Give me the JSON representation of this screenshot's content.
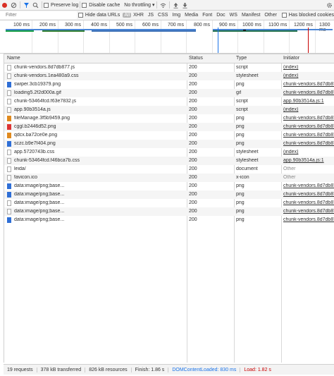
{
  "toolbar": {
    "preserve_log": "Preserve log",
    "disable_cache": "Disable cache",
    "throttling": "No throttling"
  },
  "filterbar": {
    "placeholder": "Filter",
    "hide_data_urls": "Hide data URLs",
    "types": [
      "All",
      "XHR",
      "JS",
      "CSS",
      "Img",
      "Media",
      "Font",
      "Doc",
      "WS",
      "Manifest",
      "Other"
    ],
    "selected_type": "All",
    "has_blocked_cookies": "Has blocked cookies"
  },
  "overview": {
    "ticks": [
      "100 ms",
      "200 ms",
      "300 ms",
      "400 ms",
      "500 ms",
      "600 ms",
      "700 ms",
      "800 ms",
      "900 ms",
      "1000 ms",
      "1100 ms",
      "1200 ms",
      "1300 ms"
    ]
  },
  "table": {
    "headers": {
      "name": "Name",
      "status": "Status",
      "type": "Type",
      "initiator": "Initiator"
    },
    "rows": [
      {
        "name": "chunk-vendors.8d7db877.js",
        "status": "200",
        "type": "script",
        "initiator": "(index)",
        "icon": "script"
      },
      {
        "name": "chunk-vendors.1ea480a9.css",
        "status": "200",
        "type": "stylesheet",
        "initiator": "(index)",
        "icon": "doc"
      },
      {
        "name": "swiper.3cb19379.png",
        "status": "200",
        "type": "png",
        "initiator": "chunk-vendors.8d7db877",
        "icon": "img-blue"
      },
      {
        "name": "loading5.2f2d000a.gif",
        "status": "200",
        "type": "gif",
        "initiator": "chunk-vendors.8d7db877",
        "icon": "doc"
      },
      {
        "name": "chunk-53464fcd.f63e7832.js",
        "status": "200",
        "type": "script",
        "initiator": "app.90b3514a.js:1",
        "icon": "doc"
      },
      {
        "name": "app.90b3514a.js",
        "status": "200",
        "type": "script",
        "initiator": "(index)",
        "icon": "doc"
      },
      {
        "name": "fileManage.3f5b9459.png",
        "status": "200",
        "type": "png",
        "initiator": "chunk-vendors.8d7db877",
        "icon": "img-orange"
      },
      {
        "name": "cggl.b2446d52.png",
        "status": "200",
        "type": "png",
        "initiator": "chunk-vendors.8d7db877",
        "icon": "img-red"
      },
      {
        "name": "qdcx.ba72ce0e.png",
        "status": "200",
        "type": "png",
        "initiator": "chunk-vendors.8d7db877",
        "icon": "img-orange"
      },
      {
        "name": "sczc.b9e7f404.png",
        "status": "200",
        "type": "png",
        "initiator": "chunk-vendors.8d7db877",
        "icon": "img-blue"
      },
      {
        "name": "app.5720743b.css",
        "status": "200",
        "type": "stylesheet",
        "initiator": "(index)",
        "icon": "doc"
      },
      {
        "name": "chunk-53464fcd.f46bca7b.css",
        "status": "200",
        "type": "stylesheet",
        "initiator": "app.90b3514a.js:1",
        "icon": "doc"
      },
      {
        "name": "leida/",
        "status": "200",
        "type": "document",
        "initiator": "Other",
        "icon": "doc"
      },
      {
        "name": "favicon.ico",
        "status": "200",
        "type": "x-icon",
        "initiator": "Other",
        "icon": "doc"
      },
      {
        "name": "data:image/png;base...",
        "status": "200",
        "type": "png",
        "initiator": "chunk-vendors.8d7db877",
        "icon": "img-blue"
      },
      {
        "name": "data:image/png;base...",
        "status": "200",
        "type": "png",
        "initiator": "chunk-vendors.8d7db877",
        "icon": "img-blue"
      },
      {
        "name": "data:image/png;base...",
        "status": "200",
        "type": "png",
        "initiator": "chunk-vendors.8d7db877",
        "icon": "doc"
      },
      {
        "name": "data:image/png;base...",
        "status": "200",
        "type": "png",
        "initiator": "chunk-vendors.8d7db877",
        "icon": "doc"
      },
      {
        "name": "data:image/png;base...",
        "status": "200",
        "type": "png",
        "initiator": "chunk-vendors.8d7db877",
        "icon": "img-blue"
      }
    ]
  },
  "statusbar": {
    "requests": "19 requests",
    "transferred": "378 kB transferred",
    "resources": "826 kB resources",
    "finish": "Finish: 1.86 s",
    "dom_content_loaded": "DOMContentLoaded: 830 ms",
    "load": "Load: 1.82 s"
  },
  "colors": {
    "record": "#d93025",
    "accent": "#1a73e8",
    "load": "#c80000"
  },
  "icons": [
    "record-icon",
    "clear-icon",
    "filter-icon",
    "search-icon",
    "wifi-icon",
    "upload-icon",
    "download-icon",
    "gear-icon"
  ]
}
